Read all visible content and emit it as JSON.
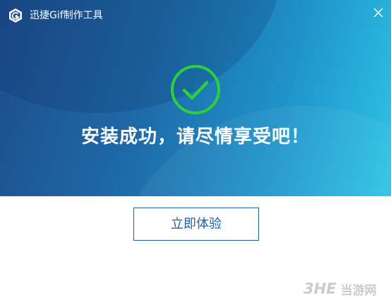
{
  "window": {
    "title": "迅捷Gif制作工具"
  },
  "icons": {
    "logo": "app-logo-icon",
    "close": "close-icon",
    "success": "check-circle-icon"
  },
  "colors": {
    "gradient_start": "#1d4d8c",
    "gradient_end": "#2ec4e6",
    "success_green": "#2fcf3c",
    "button_accent": "#1d5fa8",
    "watermark_gray": "#c7ccd2"
  },
  "main": {
    "headline": "安装成功，请尽情享受吧！",
    "primary_button_label": "立即体验"
  },
  "watermark": {
    "mark": "3HE",
    "text": "当游网"
  }
}
